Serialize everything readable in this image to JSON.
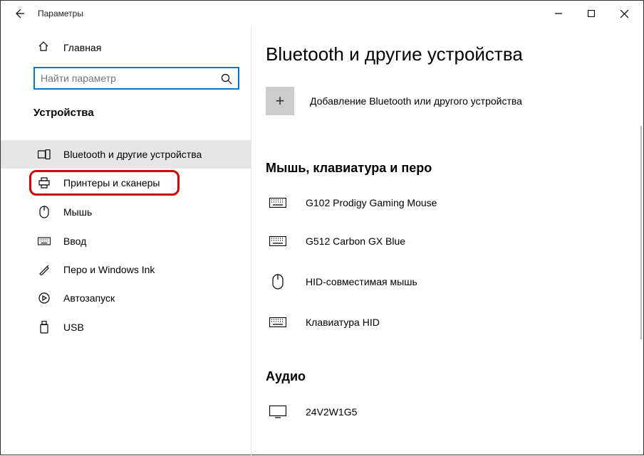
{
  "window": {
    "title": "Параметры"
  },
  "sidebar": {
    "home_label": "Главная",
    "search_placeholder": "Найти параметр",
    "section_label": "Устройства",
    "items": [
      {
        "label": "Bluetooth и другие устройства"
      },
      {
        "label": "Принтеры и сканеры"
      },
      {
        "label": "Мышь"
      },
      {
        "label": "Ввод"
      },
      {
        "label": "Перо и Windows Ink"
      },
      {
        "label": "Автозапуск"
      },
      {
        "label": "USB"
      }
    ]
  },
  "content": {
    "page_title": "Bluetooth и другие устройства",
    "add_device_label": "Добавление Bluetooth или другого устройства",
    "section1_title": "Мышь, клавиатура и перо",
    "devices": [
      {
        "name": "G102 Prodigy Gaming Mouse",
        "icon": "keyboard"
      },
      {
        "name": "G512 Carbon GX Blue",
        "icon": "keyboard"
      },
      {
        "name": "HID-совместимая мышь",
        "icon": "mouse"
      },
      {
        "name": "Клавиатура HID",
        "icon": "keyboard"
      }
    ],
    "section2_title": "Аудио",
    "audio_devices": [
      {
        "name": "24V2W1G5",
        "icon": "monitor"
      }
    ]
  }
}
